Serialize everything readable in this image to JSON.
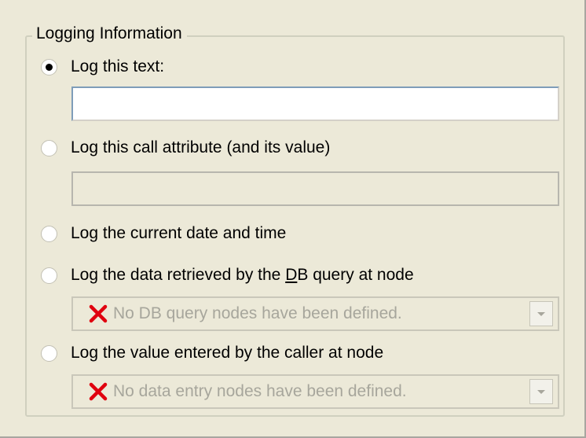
{
  "group": {
    "title": "Logging Information"
  },
  "options": [
    {
      "label": "Log this text:",
      "checked": true
    },
    {
      "label": "Log this call attribute (and its value)",
      "checked": false
    },
    {
      "label": "Log the current date and time",
      "checked": false
    },
    {
      "label_before": "Log the data retrieved by the ",
      "label_mnemonic": "D",
      "label_after": "B query at node",
      "checked": false
    },
    {
      "label": "Log the value entered by the caller at node",
      "checked": false
    }
  ],
  "inputs": {
    "log_text": {
      "value": ""
    },
    "call_attribute": {
      "value": ""
    }
  },
  "dropdowns": {
    "db_query_node": {
      "value": "No DB query nodes have been defined.",
      "icon": "red-x-icon",
      "disabled": true
    },
    "data_entry_node": {
      "value": "No data entry nodes have been defined.",
      "icon": "red-x-icon",
      "disabled": true
    }
  },
  "colors": {
    "background": "#ece9d8",
    "disabled_text": "#a7a69c",
    "error_icon": "#e0000f"
  }
}
